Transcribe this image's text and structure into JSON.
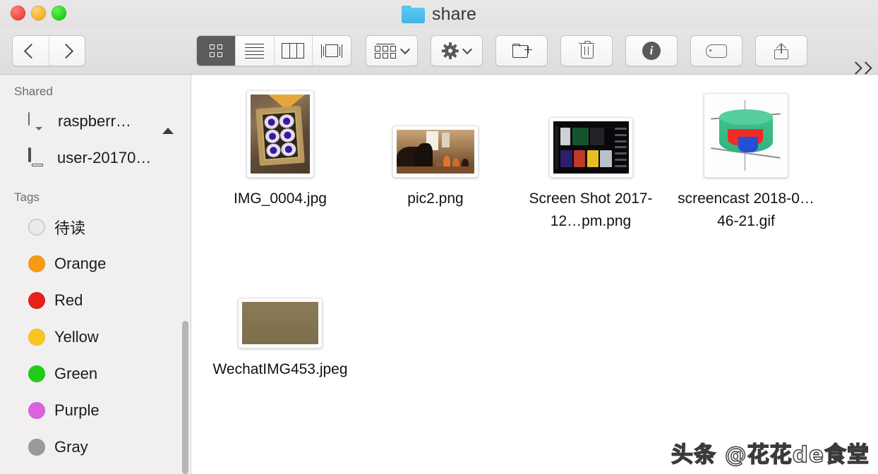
{
  "window": {
    "title": "share",
    "title_icon": "blue-folder-icon",
    "traffic_lights": [
      {
        "name": "close",
        "color": "#f2453b"
      },
      {
        "name": "minimize",
        "color": "#f6b018"
      },
      {
        "name": "zoom",
        "color": "#1dcf15"
      }
    ]
  },
  "toolbar": {
    "back_label": "",
    "forward_label": "",
    "view_modes": [
      {
        "name": "icon-view",
        "icon": "grid-icon",
        "active": true
      },
      {
        "name": "list-view",
        "icon": "list-icon",
        "active": false
      },
      {
        "name": "column-view",
        "icon": "columns-icon",
        "active": false
      },
      {
        "name": "gallery-view",
        "icon": "gallery-icon",
        "active": false
      }
    ],
    "arrange_icon": "arrange-grid-icon",
    "action_icon": "gear-icon",
    "new_folder_icon": "new-folder-icon",
    "delete_icon": "trash-icon",
    "info_icon": "info-icon",
    "info_glyph": "i",
    "tag_icon": "tag-icon",
    "share_icon": "share-icon",
    "overflow_icon": "double-chevron-right-icon"
  },
  "sidebar": {
    "sections": [
      {
        "header": "Shared",
        "items": [
          {
            "label": "raspberr…",
            "icon": "display-icon",
            "eject": true
          },
          {
            "label": "user-20170…",
            "icon": "computer-icon",
            "eject": false
          }
        ]
      },
      {
        "header": "Tags",
        "items": [
          {
            "label": "待读",
            "color": "#eceaeb",
            "hollow": true
          },
          {
            "label": "Orange",
            "color": "#f79a12",
            "hollow": false
          },
          {
            "label": "Red",
            "color": "#e8201c",
            "hollow": false
          },
          {
            "label": "Yellow",
            "color": "#f9c520",
            "hollow": false
          },
          {
            "label": "Green",
            "color": "#22cc16",
            "hollow": false
          },
          {
            "label": "Purple",
            "color": "#db62e0",
            "hollow": false
          },
          {
            "label": "Gray",
            "color": "#9a9a9e",
            "hollow": false
          }
        ]
      }
    ]
  },
  "files": [
    {
      "name": "IMG_0004.jpg",
      "art": "photo-box-of-cupcakes",
      "thumb_w": 94,
      "thumb_h": 122
    },
    {
      "name": "pic2.png",
      "art": "photo-people-in-room",
      "thumb_w": 120,
      "thumb_h": 72
    },
    {
      "name": "Screen Shot 2017-12…pm.png",
      "art": "screenshot-dark-media-app",
      "thumb_w": 117,
      "thumb_h": 84
    },
    {
      "name": "screencast 2018-0…46-21.gif",
      "art": "3d-cylinder-plot",
      "thumb_w": 118,
      "thumb_h": 118
    },
    {
      "name": "WechatIMG453.jpeg",
      "art": "photo-plaque-with-text",
      "thumb_w": 118,
      "thumb_h": 70
    }
  ],
  "watermark": {
    "text": "头条 @花花de食堂"
  }
}
